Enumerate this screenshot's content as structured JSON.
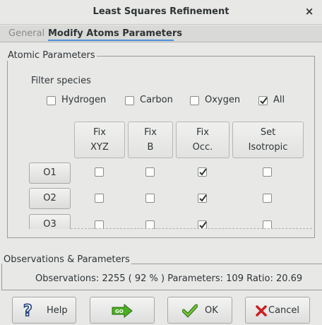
{
  "window": {
    "title": "Least Squares Refinement",
    "close_glyph": "×"
  },
  "tabs": [
    {
      "label": "General",
      "active": false
    },
    {
      "label": "Modify Atoms Parameters",
      "active": true
    }
  ],
  "atomic": {
    "group_label": "Atomic Parameters",
    "filter_label": "Filter species",
    "filters": [
      {
        "label": "Hydrogen",
        "checked": false
      },
      {
        "label": "Carbon",
        "checked": false
      },
      {
        "label": "Oxygen",
        "checked": false
      },
      {
        "label": "All",
        "checked": true
      }
    ],
    "columns": [
      {
        "line1": "Fix",
        "line2": "XYZ"
      },
      {
        "line1": "Fix",
        "line2": "B"
      },
      {
        "line1": "Fix",
        "line2": "Occ."
      },
      {
        "line1": "Set",
        "line2": "Isotropic"
      }
    ],
    "rows": [
      {
        "label": "O1",
        "checks": [
          false,
          false,
          true,
          false
        ]
      },
      {
        "label": "O2",
        "checks": [
          false,
          false,
          true,
          false
        ]
      },
      {
        "label": "O3",
        "checks": [
          false,
          false,
          true,
          false
        ]
      }
    ]
  },
  "observations": {
    "group_label": "Observations & Parameters",
    "text": "Observations: 2255 ( 92 % ) Parameters: 109  Ratio: 20.69"
  },
  "buttons": {
    "help": "Help",
    "go_icon_text": "GO",
    "ok": "OK",
    "cancel": "Cancel"
  },
  "colors": {
    "accent": "#4a90d9",
    "go_green": "#4caf22",
    "cancel_red": "#cc1f1f"
  }
}
